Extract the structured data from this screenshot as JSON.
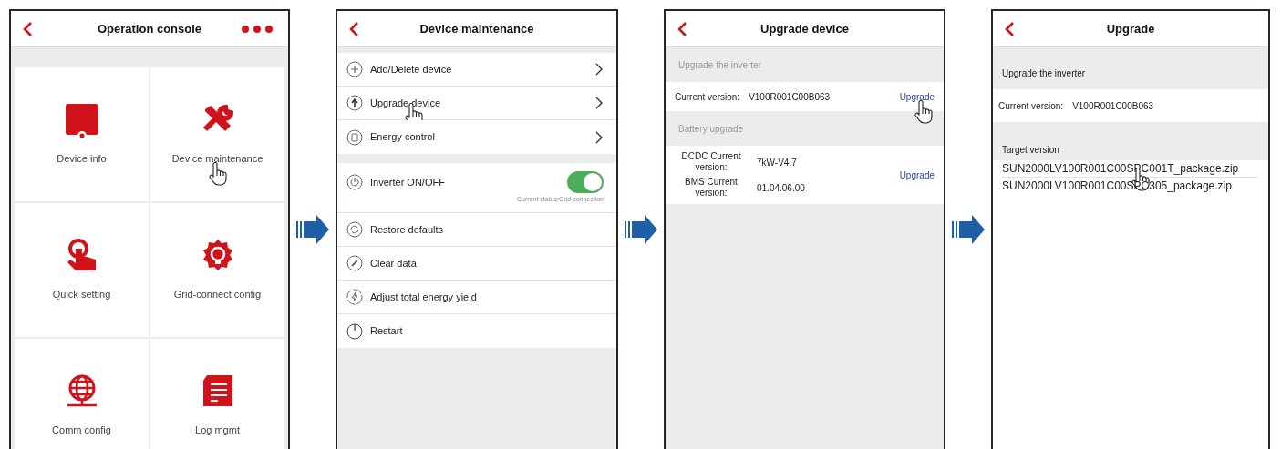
{
  "screens": [
    {
      "kind": "grid",
      "title": "Operation console",
      "menu": true,
      "tiles": [
        {
          "label": "Device info",
          "tapped": false
        },
        {
          "label": "Device maintenance",
          "tapped": true
        },
        {
          "label": "Quick setting",
          "tapped": false
        },
        {
          "label": "Grid-connect config",
          "tapped": false
        },
        {
          "label": "Comm config",
          "tapped": false
        },
        {
          "label": "Log mgmt",
          "tapped": false
        }
      ]
    },
    {
      "kind": "list",
      "title": "Device maintenance",
      "groups": [
        [
          {
            "kind": "link",
            "label": "Add/Delete device",
            "tapped": false
          },
          {
            "kind": "link",
            "label": "Upgrade device",
            "tapped": true
          },
          {
            "kind": "link",
            "label": "Energy control",
            "tapped": false
          }
        ],
        [
          {
            "kind": "toggle",
            "label": "Inverter ON/OFF",
            "on": true,
            "note": "Current status:Grid connection",
            "tapped": false
          },
          {
            "kind": "plain",
            "label": "Restore defaults",
            "tapped": false
          },
          {
            "kind": "plain",
            "label": "Clear data",
            "tapped": false
          },
          {
            "kind": "plain",
            "label": "Adjust total energy yield",
            "tapped": false
          },
          {
            "kind": "plain",
            "label": "Restart",
            "tapped": false
          }
        ]
      ]
    },
    {
      "kind": "versions",
      "title": "Upgrade device",
      "sections": [
        {
          "header": "Upgrade the inverter",
          "pairs": [
            {
              "label": "Current version:",
              "value": "V100R001C00B063"
            }
          ],
          "action": "Upgrade",
          "tapped": true
        },
        {
          "header": "Battery upgrade",
          "pairs": [
            {
              "label": "DCDC Current version:",
              "value": "7kW-V4.7"
            },
            {
              "label": "BMS Current version:",
              "value": "01.04.06.00"
            }
          ],
          "action": "Upgrade",
          "tapped": false
        }
      ]
    },
    {
      "kind": "packages",
      "title": "Upgrade",
      "header": "Upgrade the inverter",
      "current_label": "Current version:",
      "current_value": "V100R001C00B063",
      "target_header": "Target version",
      "packages": [
        {
          "name": "SUN2000LV100R001C00SPC001T_package.zip",
          "tapped": true
        },
        {
          "name": "SUN2000LV100R001C00SPC305_package.zip",
          "tapped": false
        }
      ]
    }
  ]
}
